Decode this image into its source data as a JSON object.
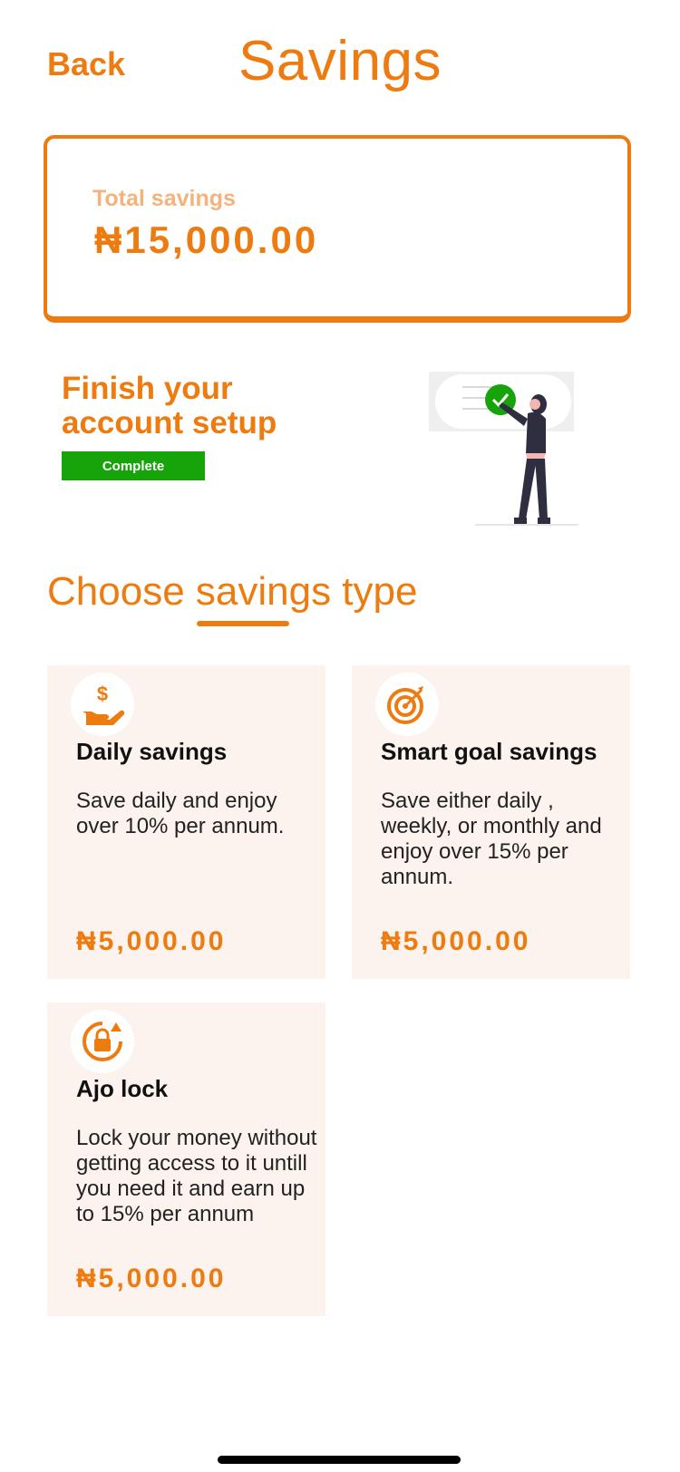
{
  "header": {
    "back_label": "Back",
    "title": "Savings"
  },
  "total": {
    "label": "Total savings",
    "amount": "₦15,000.00"
  },
  "setup": {
    "title": "Finish your account setup",
    "button_label": "Complete"
  },
  "choose": {
    "title": "Choose savings type"
  },
  "cards": [
    {
      "icon": "hand-coin-icon",
      "name": "Daily savings",
      "description": "Save daily and enjoy over 10% per annum.",
      "amount": "₦5,000.00"
    },
    {
      "icon": "target-icon",
      "name": "Smart goal savings",
      "description": "Save either daily , weekly, or monthly and enjoy over 15% per annum.",
      "amount": "₦5,000.00"
    },
    {
      "icon": "lock-refresh-icon",
      "name": "Ajo lock",
      "description": "Lock your money without getting access to it untill you need it and earn up to 15% per annum",
      "amount": "₦5,000.00"
    }
  ],
  "colors": {
    "accent": "#EE7B0F",
    "accent_light": "#F5B27A",
    "complete_green": "#17A40B",
    "card_bg": "#FDF3EE"
  }
}
